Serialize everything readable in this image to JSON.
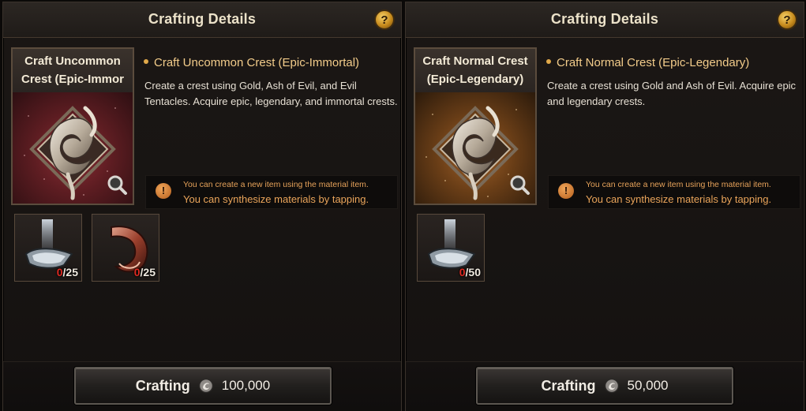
{
  "panels": [
    {
      "title": "Crafting Details",
      "help_icon": "?",
      "item_name": "Craft Uncommon Crest (Epic-Immor",
      "item_color": "#8b2e35",
      "description_title": "Craft Uncommon Crest (Epic-Immortal)",
      "description": "Create a crest using Gold, Ash of Evil, and Evil Tentacles. Acquire epic, legendary, and immortal crests.",
      "notice_icon": "!",
      "notice_line1": "You can create a new item using the material item.",
      "notice_line2": "You can synthesize materials by tapping.",
      "materials": [
        {
          "icon": "ash-of-evil-icon",
          "have": "0",
          "need": "/25"
        },
        {
          "icon": "evil-tentacle-icon",
          "have": "0",
          "need": "/25"
        }
      ],
      "button_label": "Crafting",
      "cost": "100,000"
    },
    {
      "title": "Crafting Details",
      "help_icon": "?",
      "item_name": "Craft Normal Crest (Epic-Legendary)",
      "item_color": "#a2622a",
      "description_title": "Craft Normal Crest (Epic-Legendary)",
      "description": "Create a crest using Gold and Ash of Evil. Acquire epic and legendary crests.",
      "notice_icon": "!",
      "notice_line1": "You can create a new item using the material item.",
      "notice_line2": "You can synthesize materials by tapping.",
      "materials": [
        {
          "icon": "ash-of-evil-icon",
          "have": "0",
          "need": "/50"
        }
      ],
      "button_label": "Crafting",
      "cost": "50,000"
    }
  ]
}
